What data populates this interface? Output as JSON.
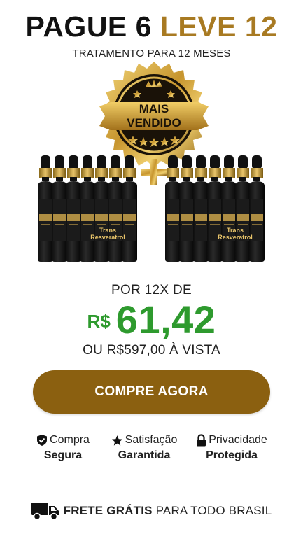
{
  "headline": {
    "part1": "PAGUE 6",
    "part2": "LEVE 12"
  },
  "subhead": "TRATAMENTO PARA 12 MESES",
  "seal": {
    "line1": "MAIS",
    "line2": "VENDIDO",
    "plus": "+"
  },
  "product": {
    "label_line1": "Trans",
    "label_line2": "Resveratrol",
    "label_line3": "Gold"
  },
  "pricing": {
    "installments": "POR 12X DE",
    "currency": "R$",
    "amount": "61,42",
    "cash_price": "OU R$597,00 À VISTA"
  },
  "cta": {
    "label": "COMPRE AGORA"
  },
  "badges": [
    {
      "icon": "shield-check-icon",
      "top": "Compra",
      "bottom": "Segura"
    },
    {
      "icon": "star-icon",
      "top": "Satisfação",
      "bottom": "Garantida"
    },
    {
      "icon": "lock-icon",
      "top": "Privacidade",
      "bottom": "Protegida"
    }
  ],
  "shipping": {
    "icon": "truck-icon",
    "bold": "FRETE GRÁTIS",
    "rest": "PARA TODO BRASIL"
  },
  "colors": {
    "gold": "#a87a22",
    "green": "#2e9a2e",
    "button": "#8b6010"
  }
}
